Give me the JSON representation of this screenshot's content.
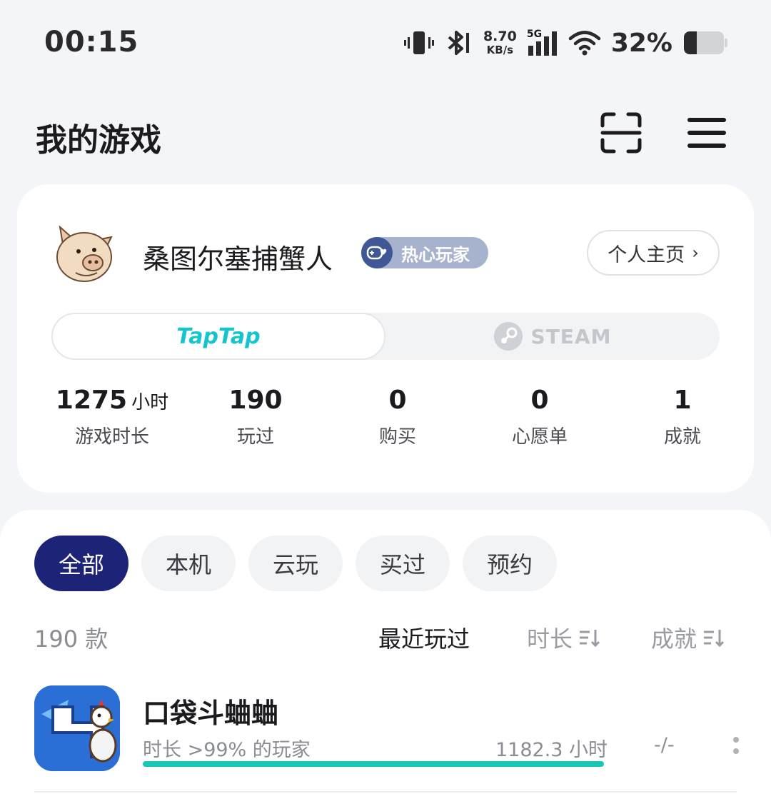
{
  "status_bar": {
    "time": "00:15",
    "net_speed_value": "8.70",
    "net_speed_unit": "KB/s",
    "network_type": "5G",
    "battery_percent": "32%",
    "battery_level": 0.32
  },
  "header": {
    "title": "我的游戏",
    "scan_icon": "scan-icon",
    "menu_icon": "menu-icon"
  },
  "profile": {
    "username": "桑图尔塞捕蟹人",
    "badge_label": "热心玩家",
    "home_button_label": "个人主页",
    "platform_tabs": {
      "taptap": "TapTap",
      "steam": "STEAM",
      "selected": "taptap"
    },
    "stats": [
      {
        "value": "1275",
        "unit": "小时",
        "label": "游戏时长"
      },
      {
        "value": "190",
        "label": "玩过"
      },
      {
        "value": "0",
        "label": "购买"
      },
      {
        "value": "0",
        "label": "心愿单"
      },
      {
        "value": "1",
        "label": "成就"
      }
    ]
  },
  "filters": {
    "items": [
      "全部",
      "本机",
      "云玩",
      "买过",
      "预约"
    ],
    "active": "全部"
  },
  "list": {
    "count": "190 款",
    "sort_recent": "最近玩过",
    "sort_duration": "时长",
    "sort_achievement": "成就"
  },
  "games": [
    {
      "title": "口袋斗蛐蛐",
      "percentile_text": "时长 >99% 的玩家",
      "hours": "1182.3 小时",
      "progress": 1.0,
      "achievements": "-/-"
    }
  ],
  "colors": {
    "accent_dark": "#1d2477",
    "taptap_teal": "#15c5ce",
    "progress": "#19c7b8",
    "badge_bg": "#a7b2cf"
  }
}
